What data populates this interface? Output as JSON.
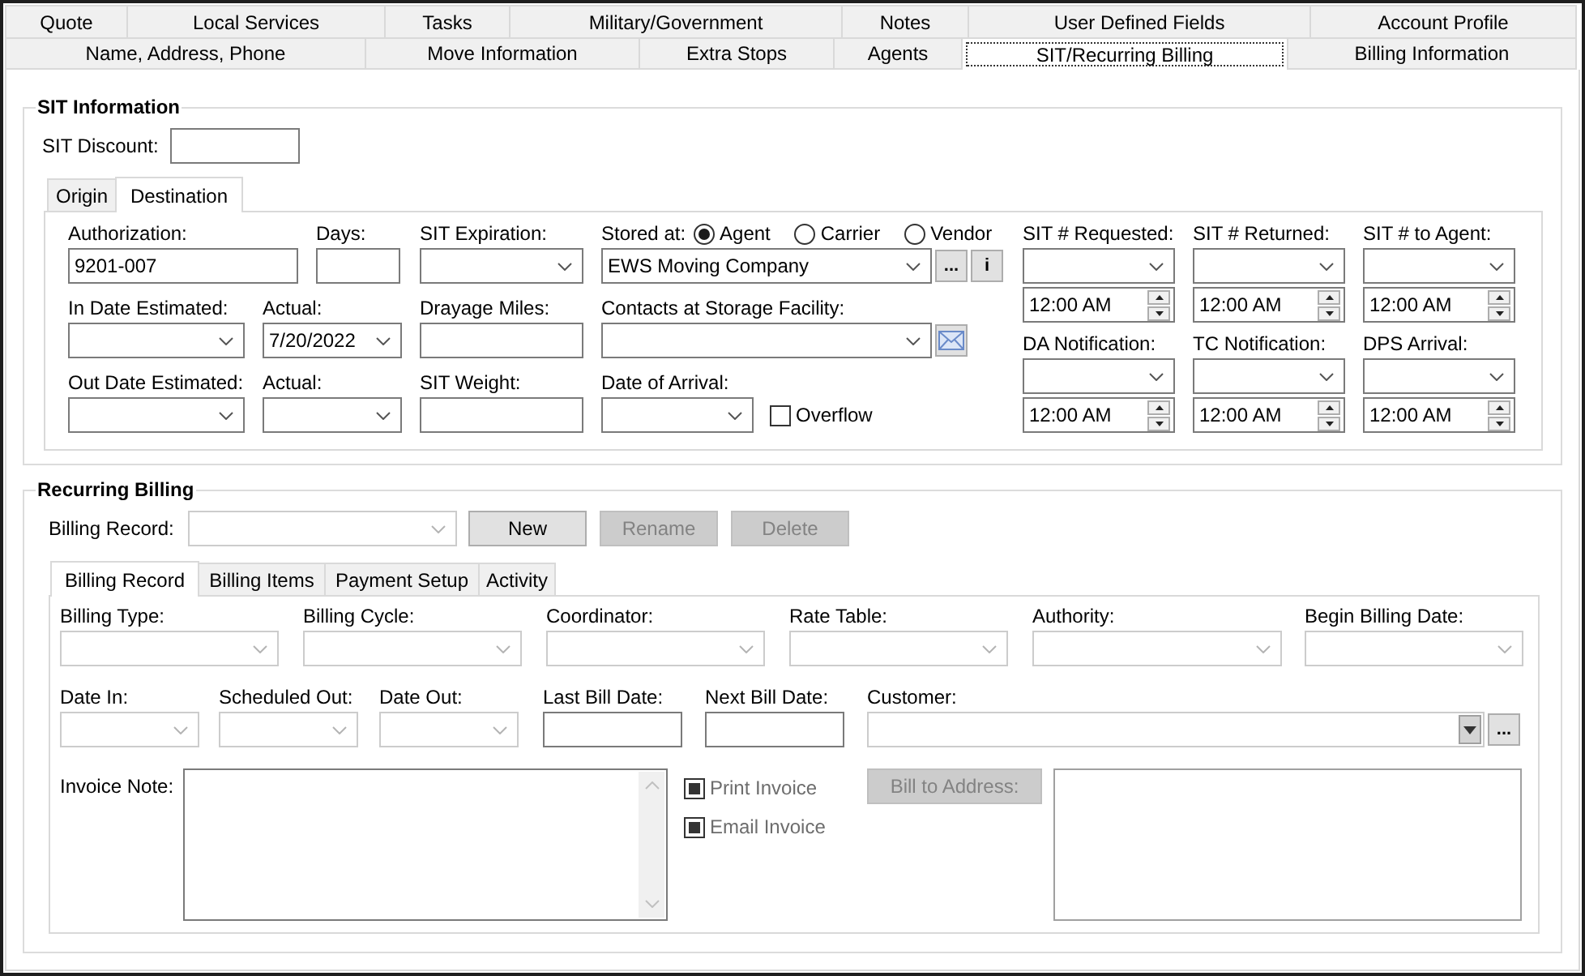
{
  "tab_rows": [
    [
      {
        "label": "Quote",
        "selected": false
      },
      {
        "label": "Local Services",
        "selected": false
      },
      {
        "label": "Tasks",
        "selected": false
      },
      {
        "label": "Military/Government",
        "selected": false
      },
      {
        "label": "Notes",
        "selected": false
      },
      {
        "label": "User Defined Fields",
        "selected": false
      },
      {
        "label": "Account Profile",
        "selected": false
      }
    ],
    [
      {
        "label": "Name, Address, Phone",
        "selected": false
      },
      {
        "label": "Move Information",
        "selected": false
      },
      {
        "label": "Extra Stops",
        "selected": false
      },
      {
        "label": "Agents",
        "selected": false
      },
      {
        "label": "SIT/Recurring Billing",
        "selected": true
      },
      {
        "label": "Billing Information",
        "selected": false
      }
    ]
  ],
  "sit_information": {
    "title": "SIT Information",
    "discount": {
      "label": "SIT Discount:"
    },
    "location_tabs": [
      {
        "label": "Origin",
        "selected": false
      },
      {
        "label": "Destination",
        "selected": true
      }
    ],
    "field_rows": [
      [
        {
          "kind": "text",
          "label": "Authorization:",
          "value": "9201-007"
        },
        {
          "kind": "text",
          "label": "Days:"
        },
        {
          "kind": "combo",
          "label": "SIT Expiration:"
        },
        {
          "kind": "combo",
          "label": "Stored at:",
          "options": [
            {
              "label": "Agent",
              "selected": true
            },
            {
              "label": "Carrier",
              "selected": false
            },
            {
              "label": "Vendor",
              "selected": false
            }
          ],
          "value": "EWS Moving Company",
          "buttons": [
            "...",
            "i"
          ]
        }
      ],
      [
        {
          "kind": "combo",
          "label": "In Date Estimated:"
        },
        {
          "kind": "combo",
          "label": "Actual:",
          "value": "7/20/2022"
        },
        {
          "kind": "text",
          "label": "Drayage Miles:"
        },
        {
          "kind": "combo",
          "label": "Contacts at Storage Facility:",
          "email_button": true
        }
      ],
      [
        {
          "kind": "combo",
          "label": "Out Date Estimated:"
        },
        {
          "kind": "combo",
          "label": "Actual:"
        },
        {
          "kind": "text",
          "label": "SIT Weight:"
        },
        {
          "kind": "combo",
          "label": "Date of Arrival:",
          "checkbox": {
            "label": "Overflow",
            "checked": false
          }
        }
      ]
    ],
    "milestones": [
      {
        "label": "SIT # Requested:",
        "time": "12:00 AM"
      },
      {
        "label": "SIT # Returned:",
        "time": "12:00 AM"
      },
      {
        "label": "SIT # to Agent:",
        "time": "12:00 AM"
      },
      {
        "label": "DA Notification:",
        "time": "12:00 AM"
      },
      {
        "label": "TC Notification:",
        "time": "12:00 AM"
      },
      {
        "label": "DPS Arrival:",
        "time": "12:00 AM"
      }
    ]
  },
  "recurring_billing": {
    "title": "Recurring Billing",
    "billing_record": {
      "label": "Billing Record:",
      "disabled": true
    },
    "buttons": [
      {
        "label": "New",
        "disabled": false
      },
      {
        "label": "Rename",
        "disabled": true
      },
      {
        "label": "Delete",
        "disabled": true
      }
    ],
    "tabs": [
      {
        "label": "Billing Record",
        "selected": true
      },
      {
        "label": "Billing Items",
        "selected": false
      },
      {
        "label": "Payment Setup",
        "selected": false
      },
      {
        "label": "Activity",
        "selected": false
      }
    ],
    "field_rows": [
      [
        {
          "kind": "combo",
          "label": "Billing Type:",
          "disabled": true
        },
        {
          "kind": "combo",
          "label": "Billing Cycle:",
          "disabled": true
        },
        {
          "kind": "combo",
          "label": "Coordinator:",
          "disabled": true
        },
        {
          "kind": "combo",
          "label": "Rate Table:",
          "disabled": true
        },
        {
          "kind": "combo",
          "label": "Authority:",
          "disabled": true
        },
        {
          "kind": "combo",
          "label": "Begin Billing Date:",
          "disabled": true
        }
      ],
      [
        {
          "kind": "combo",
          "label": "Date In:",
          "disabled": true
        },
        {
          "kind": "combo",
          "label": "Scheduled Out:",
          "disabled": true
        },
        {
          "kind": "combo",
          "label": "Date Out:",
          "disabled": true
        },
        {
          "kind": "text",
          "label": "Last Bill Date:",
          "disabled": false
        },
        {
          "kind": "text",
          "label": "Next Bill Date:",
          "disabled": false
        },
        {
          "kind": "lookup",
          "label": "Customer:",
          "disabled": false,
          "buttons": [
            "..."
          ]
        }
      ]
    ],
    "invoice_note": {
      "label": "Invoice Note:"
    },
    "checkboxes": [
      {
        "label": "Print Invoice",
        "checked": true,
        "disabled": true
      },
      {
        "label": "Email Invoice",
        "checked": true,
        "disabled": true
      }
    ],
    "bill_to_address": {
      "label": "Bill to Address:",
      "disabled": true
    }
  }
}
